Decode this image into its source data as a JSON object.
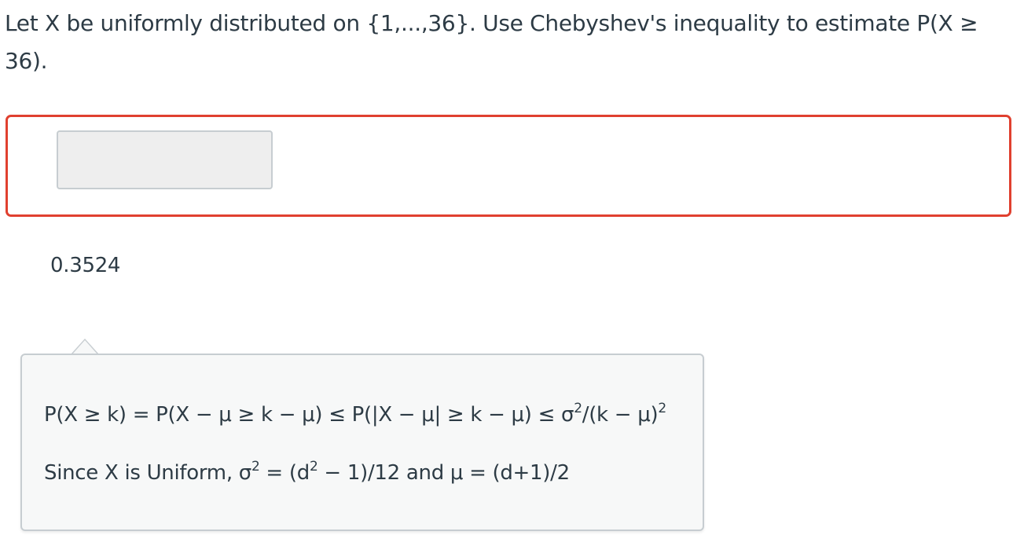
{
  "question": {
    "text": "Let X be uniformly distributed on {1,...,36}.  Use Chebyshev's inequality to estimate P(X ≥ 36)."
  },
  "answer": {
    "input_value": "",
    "correct_value": "0.3524"
  },
  "hint": {
    "line1_main": "P(X ≥ k) = P(X − μ ≥ k − μ) ≤ P(|X − μ| ≥ k − μ) ≤ σ",
    "line1_exp1": "2",
    "line1_mid": "/(k − μ)",
    "line1_exp2": "2",
    "line2_a": "Since X is Uniform, σ",
    "line2_exp1": "2",
    "line2_b": " = (d",
    "line2_exp2": "2",
    "line2_c": " − 1)/12 and μ = (d+1)/2"
  },
  "colors": {
    "error_border": "#e0402f",
    "input_bg": "#eeeeee",
    "hint_bg": "#f7f8f8",
    "text": "#2d3b45"
  }
}
